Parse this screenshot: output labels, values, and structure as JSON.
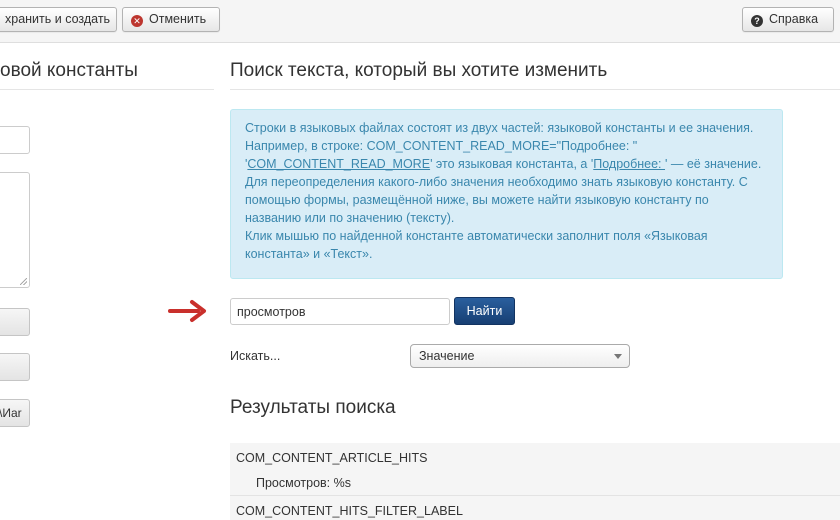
{
  "toolbar": {
    "save_new_label": "хранить и создать",
    "cancel_label": "Отменить",
    "help_label": "Справка"
  },
  "left": {
    "heading": "овой константы",
    "button3_label": "\\Иar"
  },
  "main": {
    "heading": "Поиск текста, который вы хотите изменить",
    "info": {
      "line1": "Строки в языковых файлах состоят из двух частей: языковой константы и ее значения.",
      "line2": "Например, в строке: COM_CONTENT_READ_MORE=\"Подробнее: \"",
      "q1": "'",
      "link_const": "COM_CONTENT_READ_MORE",
      "mid": "' это языковая константа, а '",
      "link_value": "Подробнее: ",
      "tail": "' — её значение.",
      "line4": "Для переопределения какого-либо значения необходимо знать языковую константу. С помощью формы, размещённой ниже, вы можете найти языковую константу по названию или по значению (тексту).",
      "line5": "Клик мышью по найденной константе автоматически заполнит поля «Языковая константа» и «Текст»."
    },
    "search": {
      "value": "просмотров",
      "button": "Найти",
      "label": "Искать...",
      "select_value": "Значение"
    },
    "results": {
      "heading": "Результаты поиска",
      "items": [
        {
          "constant": "COM_CONTENT_ARTICLE_HITS",
          "value": "Просмотров: %s"
        },
        {
          "constant": "COM_CONTENT_HITS_FILTER_LABEL",
          "value": ""
        }
      ]
    }
  },
  "colors": {
    "info_bg": "#d9edf7",
    "info_text": "#3a87ad",
    "primary_button": "#1f4f8a",
    "arrow": "#c9302c",
    "cancel_icon": "#bd362f"
  },
  "icons": {
    "cancel": "cancel-circle-icon",
    "help": "question-circle-icon",
    "arrow": "arrow-right-icon",
    "caret": "chevron-down-icon"
  }
}
